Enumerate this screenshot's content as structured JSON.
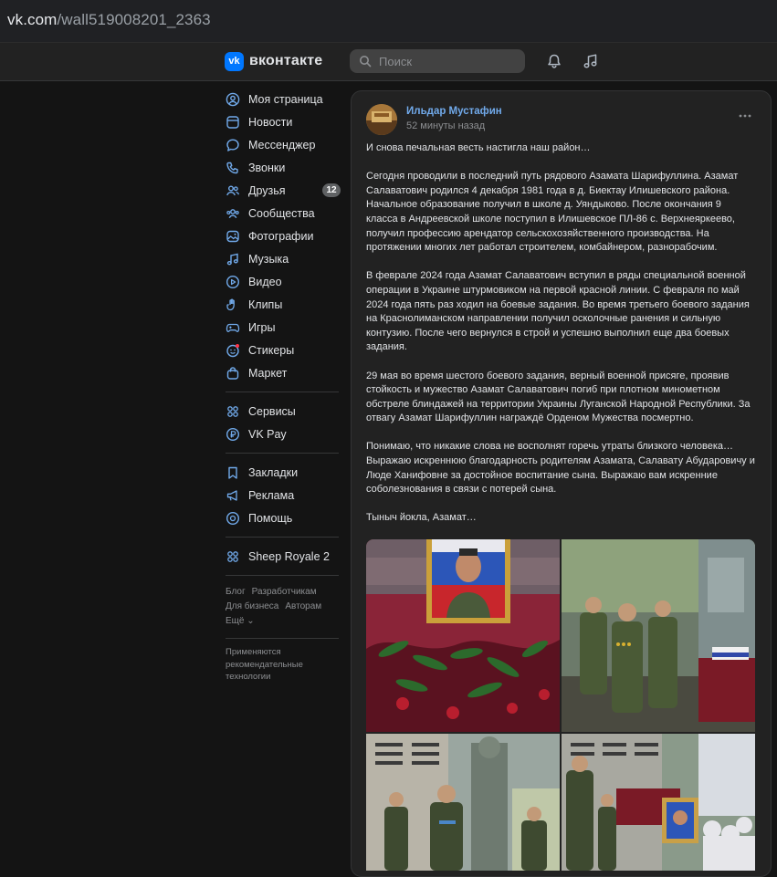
{
  "browser": {
    "url_domain": "vk.com",
    "url_path": "/wall519008201_2363"
  },
  "header": {
    "logo_text": "вконтакте",
    "logo_mark": "vk",
    "search_placeholder": "Поиск",
    "icons": [
      "bell-icon",
      "music-icon"
    ]
  },
  "colors": {
    "accent": "#0077ff",
    "link": "#71aaeb",
    "background": "#141414",
    "card": "#222222"
  },
  "sidebar": {
    "items": [
      {
        "label": "Моя страница",
        "icon": "user-circle-icon"
      },
      {
        "label": "Новости",
        "icon": "news-icon"
      },
      {
        "label": "Мессенджер",
        "icon": "message-icon"
      },
      {
        "label": "Звонки",
        "icon": "phone-icon"
      },
      {
        "label": "Друзья",
        "icon": "friends-icon",
        "badge": "12"
      },
      {
        "label": "Сообщества",
        "icon": "groups-icon"
      },
      {
        "label": "Фотографии",
        "icon": "photo-icon"
      },
      {
        "label": "Музыка",
        "icon": "music-icon"
      },
      {
        "label": "Видео",
        "icon": "video-icon"
      },
      {
        "label": "Клипы",
        "icon": "clips-icon"
      },
      {
        "label": "Игры",
        "icon": "gamepad-icon"
      },
      {
        "label": "Стикеры",
        "icon": "sticker-icon"
      },
      {
        "label": "Маркет",
        "icon": "bag-icon"
      }
    ],
    "items2": [
      {
        "label": "Сервисы",
        "icon": "services-icon"
      },
      {
        "label": "VK Pay",
        "icon": "vkpay-icon"
      }
    ],
    "items3": [
      {
        "label": "Закладки",
        "icon": "bookmark-icon"
      },
      {
        "label": "Реклама",
        "icon": "megaphone-icon"
      },
      {
        "label": "Помощь",
        "icon": "help-icon"
      }
    ],
    "items4": [
      {
        "label": "Sheep Royale 2",
        "icon": "apps-icon"
      }
    ],
    "footer_links": [
      "Блог",
      "Разработчикам",
      "Для бизнеса",
      "Авторам",
      "Ещё ⌄"
    ],
    "recommend_text": "Применяются рекомендательные технологии"
  },
  "post": {
    "author": "Ильдар Мустафин",
    "time": "52 минуты назад",
    "paragraphs": [
      "И снова печальная весть настигла наш район…",
      "Сегодня проводили в последний путь рядового Азамата Шарифуллина. Азамат Салаватович родился 4 декабря 1981 года в д. Биектау Илишевского района. Начальное образование получил в школе д. Уяндыково. После окончания 9 класса в Андреевской школе поступил в Илишевское ПЛ-86 с. Верхнеяркеево, получил профессию арендатор сельскохозяйственного производства. На протяжении многих лет работал строителем, комбайнером, разнорабочим.",
      "В феврале 2024 года Азамат Салаватович вступил в ряды специальной военной операции в Украине штурмовиком на первой красной линии. С февраля по май 2024 года пять раз ходил на боевые задания. Во время третьего боевого задания на Краснолиманском направлении получил осколочные ранения и сильную контузию. После чего вернулся в строй и успешно выполнил еще два боевых задания.",
      "29 мая во время шестого боевого задания, верный военной присяге, проявив стойкость и мужество Азамат Салаватович погиб при плотном минометном обстреле блиндажей на территории Украины Луганской Народной Республики. За отвагу Азамат Шарифуллин награждё Орденом Мужества посмертно.",
      "Понимаю, что никакие слова не восполнят горечь утраты близкого человека… Выражаю искреннюю благодарность родителям Азамата, Салавату Абударовичу и Люде Ханифовне за достойное воспитание сына. Выражаю вам искренние соболезнования в связи с потерей сына.",
      "Тыныч йокла, Азамат…"
    ],
    "photos": [
      "portrait-with-flowers-photo",
      "soldiers-at-coffin-photo",
      "memorial-monument-photo",
      "ceremony-crowd-photo"
    ]
  }
}
